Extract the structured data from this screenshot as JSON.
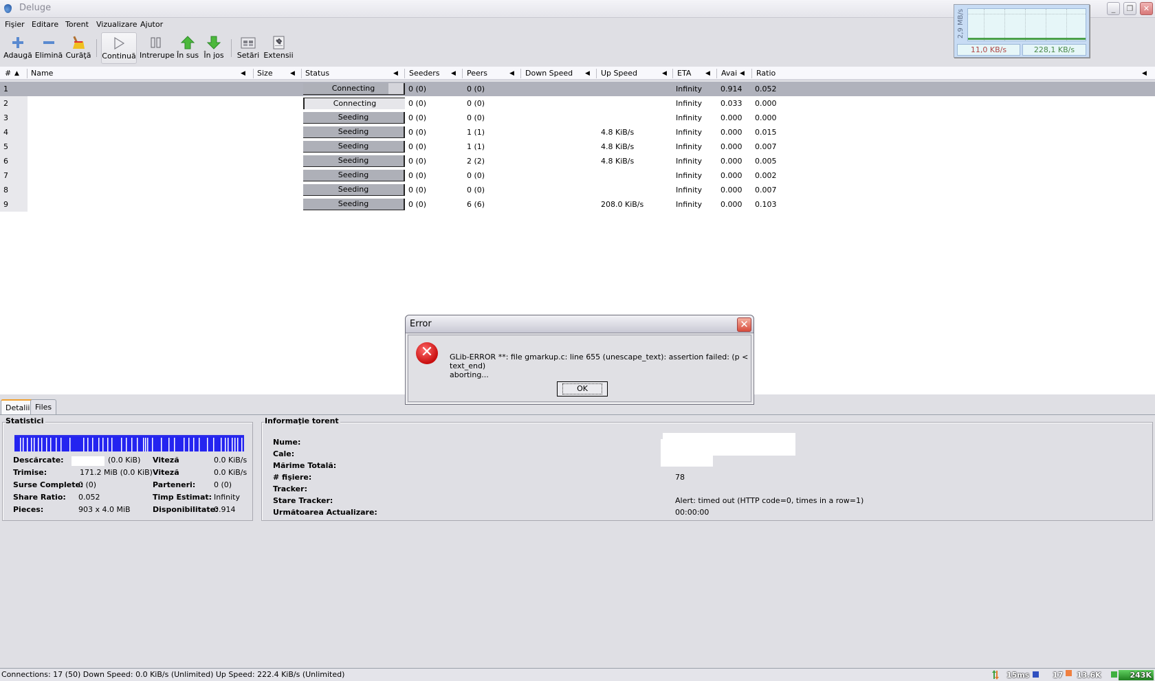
{
  "window": {
    "title": "Deluge",
    "controls": {
      "minimize": "_",
      "restore": "❐",
      "close": "✕"
    }
  },
  "menu": [
    {
      "label": "Fişier",
      "mnemonic": "F"
    },
    {
      "label": "Editare",
      "mnemonic": "E"
    },
    {
      "label": "Torent",
      "mnemonic": "T"
    },
    {
      "label": "Vizualizare",
      "mnemonic": "V"
    },
    {
      "label": "Ajutor",
      "mnemonic": "A"
    }
  ],
  "toolbar": [
    {
      "label": "Adaugă",
      "icon": "plus-icon"
    },
    {
      "label": "Elimină",
      "icon": "minus-icon"
    },
    {
      "label": "Curăţă",
      "icon": "broom-icon"
    },
    {
      "label": "Continuă",
      "icon": "play-icon"
    },
    {
      "label": "Intrerupe",
      "icon": "pause-icon"
    },
    {
      "label": "În sus",
      "icon": "arrow-up-icon"
    },
    {
      "label": "În jos",
      "icon": "arrow-down-icon"
    },
    {
      "label": "Setări",
      "icon": "settings-icon"
    },
    {
      "label": "Extensii",
      "icon": "plugins-icon"
    }
  ],
  "speed_graph": {
    "axis_label": "2,9 MB/s",
    "down": "11,0 KB/s",
    "up": "228,1 KB/s",
    "colors": {
      "down": "#b04848",
      "up": "#4a8a4a",
      "line": "#4aa04a"
    }
  },
  "columns": [
    "#",
    "Name",
    "Size",
    "Status",
    "Seeders",
    "Peers",
    "Down Speed",
    "Up Speed",
    "ETA",
    "Avai",
    "Ratio"
  ],
  "torrents": [
    {
      "num": "1",
      "status": "Connecting",
      "seeders": "0 (0)",
      "peers": "0 (0)",
      "down": "",
      "up": "",
      "eta": "Infinity",
      "avail": "0.914",
      "ratio": "0.052",
      "progress": 0.91
    },
    {
      "num": "2",
      "status": "Connecting",
      "seeders": "0 (0)",
      "peers": "0 (0)",
      "down": "",
      "up": "",
      "eta": "Infinity",
      "avail": "0.033",
      "ratio": "0.000",
      "progress": 0.03
    },
    {
      "num": "3",
      "status": "Seeding",
      "seeders": "0 (0)",
      "peers": "0 (0)",
      "down": "",
      "up": "",
      "eta": "Infinity",
      "avail": "0.000",
      "ratio": "0.000",
      "progress": 1.0
    },
    {
      "num": "4",
      "status": "Seeding",
      "seeders": "0 (0)",
      "peers": "1 (1)",
      "down": "",
      "up": "4.8 KiB/s",
      "eta": "Infinity",
      "avail": "0.000",
      "ratio": "0.015",
      "progress": 1.0
    },
    {
      "num": "5",
      "status": "Seeding",
      "seeders": "0 (0)",
      "peers": "1 (1)",
      "down": "",
      "up": "4.8 KiB/s",
      "eta": "Infinity",
      "avail": "0.000",
      "ratio": "0.007",
      "progress": 1.0
    },
    {
      "num": "6",
      "status": "Seeding",
      "seeders": "0 (0)",
      "peers": "2 (2)",
      "down": "",
      "up": "4.8 KiB/s",
      "eta": "Infinity",
      "avail": "0.000",
      "ratio": "0.005",
      "progress": 1.0
    },
    {
      "num": "7",
      "status": "Seeding",
      "seeders": "0 (0)",
      "peers": "0 (0)",
      "down": "",
      "up": "",
      "eta": "Infinity",
      "avail": "0.000",
      "ratio": "0.002",
      "progress": 1.0
    },
    {
      "num": "8",
      "status": "Seeding",
      "seeders": "0 (0)",
      "peers": "0 (0)",
      "down": "",
      "up": "",
      "eta": "Infinity",
      "avail": "0.000",
      "ratio": "0.007",
      "progress": 1.0
    },
    {
      "num": "9",
      "status": "Seeding",
      "seeders": "0 (0)",
      "peers": "6 (6)",
      "down": "",
      "up": "208.0 KiB/s",
      "eta": "Infinity",
      "avail": "0.000",
      "ratio": "0.103",
      "progress": 1.0
    }
  ],
  "dialog": {
    "title": "Error",
    "message_line1": "GLib-ERROR **: file gmarkup.c: line 655 (unescape_text): assertion failed: (p < text_end)",
    "message_line2": "aborting...",
    "ok_label": "OK"
  },
  "details_tabs": [
    "Detalii",
    "Files"
  ],
  "statistics": {
    "title": "Statistici",
    "pieces_color": "#2424f0",
    "rows": [
      {
        "label": "Descărcate:",
        "value": "(0.0 KiB)",
        "label2": "Viteză",
        "value2": "0.0 KiB/s"
      },
      {
        "label": "Trimise:",
        "value": "171.2 MiB (0.0 KiB)",
        "label2": "Viteză",
        "value2": "0.0 KiB/s"
      },
      {
        "label": "Surse Complete:",
        "value": "0 (0)",
        "label2": "Parteneri:",
        "value2": "0 (0)"
      },
      {
        "label": "Share Ratio:",
        "value": "0.052",
        "label2": "Timp Estimat:",
        "value2": "Infinity"
      },
      {
        "label": "Pieces:",
        "value": "903 x 4.0 MiB",
        "label2": "Disponibilitate:",
        "value2": "0.914"
      }
    ]
  },
  "torrent_info": {
    "title": "Informaţie torent",
    "rows": [
      {
        "label": "Nume:",
        "value": ""
      },
      {
        "label": "Cale:",
        "value": ""
      },
      {
        "label": "Mărime Totală:",
        "value": ""
      },
      {
        "label": "# fişiere:",
        "value": "78"
      },
      {
        "label": "Tracker:",
        "value": ""
      },
      {
        "label": "Stare Tracker:",
        "value": "Alert: timed out (HTTP code=0, times in a row=1)"
      },
      {
        "label": "Următoarea Actualizare:",
        "value": "00:00:00"
      }
    ]
  },
  "statusbar": {
    "text": "Connections: 17 (50)  Down Speed: 0.0 KiB/s (Unlimited)  Up Speed: 222.4 KiB/s (Unlimited)"
  },
  "tray": {
    "ping": "15ms",
    "count": "17",
    "down": "13.6K",
    "up": "243K"
  }
}
